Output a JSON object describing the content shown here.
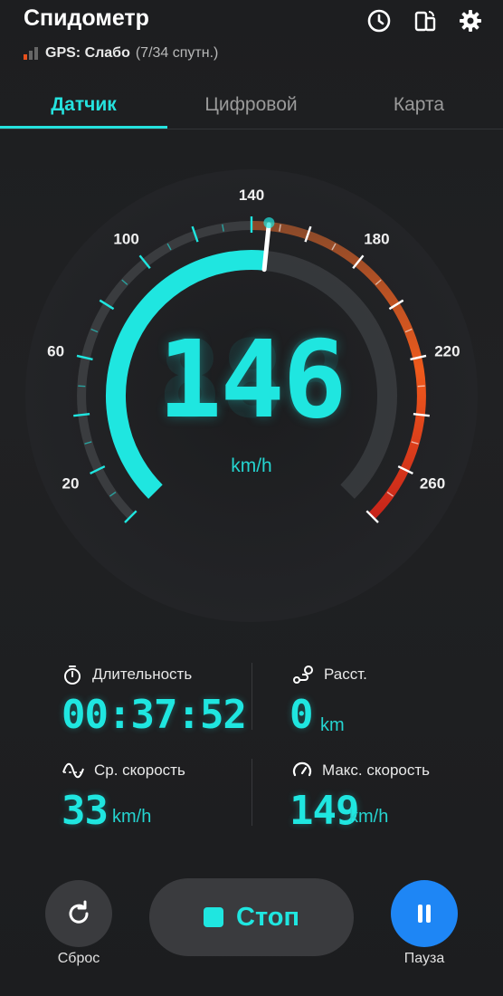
{
  "header": {
    "title": "Спидометр",
    "gps_label": "GPS: Слабо",
    "gps_satellites": "(7/34 спутн.)"
  },
  "tabs": [
    {
      "label": "Датчик",
      "active": true
    },
    {
      "label": "Цифровой",
      "active": false
    },
    {
      "label": "Карта",
      "active": false
    }
  ],
  "gauge": {
    "speed": "146",
    "speed_ghost": "888",
    "unit": "km/h",
    "max_speed_scale": 280,
    "current_speed_value": 146,
    "scale_labels": [
      "20",
      "60",
      "100",
      "140",
      "180",
      "220",
      "260"
    ],
    "colors": {
      "accent": "#1fe6e0",
      "danger": "#e8501c",
      "track": "#3a3c3f"
    }
  },
  "stats": {
    "duration": {
      "label": "Длительность",
      "value": "00:37:52",
      "icon": "stopwatch-icon"
    },
    "distance": {
      "label": "Расст.",
      "value": "0",
      "unit": "km",
      "icon": "route-icon"
    },
    "avg_speed": {
      "label": "Ср. скорость",
      "value": "33",
      "unit": "km/h",
      "icon": "wave-icon"
    },
    "max_speed": {
      "label": "Макс. скорость",
      "value": "149",
      "unit": "km/h",
      "icon": "speedometer-icon"
    }
  },
  "controls": {
    "reset_label": "Сброс",
    "stop_label": "Стоп",
    "pause_label": "Пауза"
  }
}
